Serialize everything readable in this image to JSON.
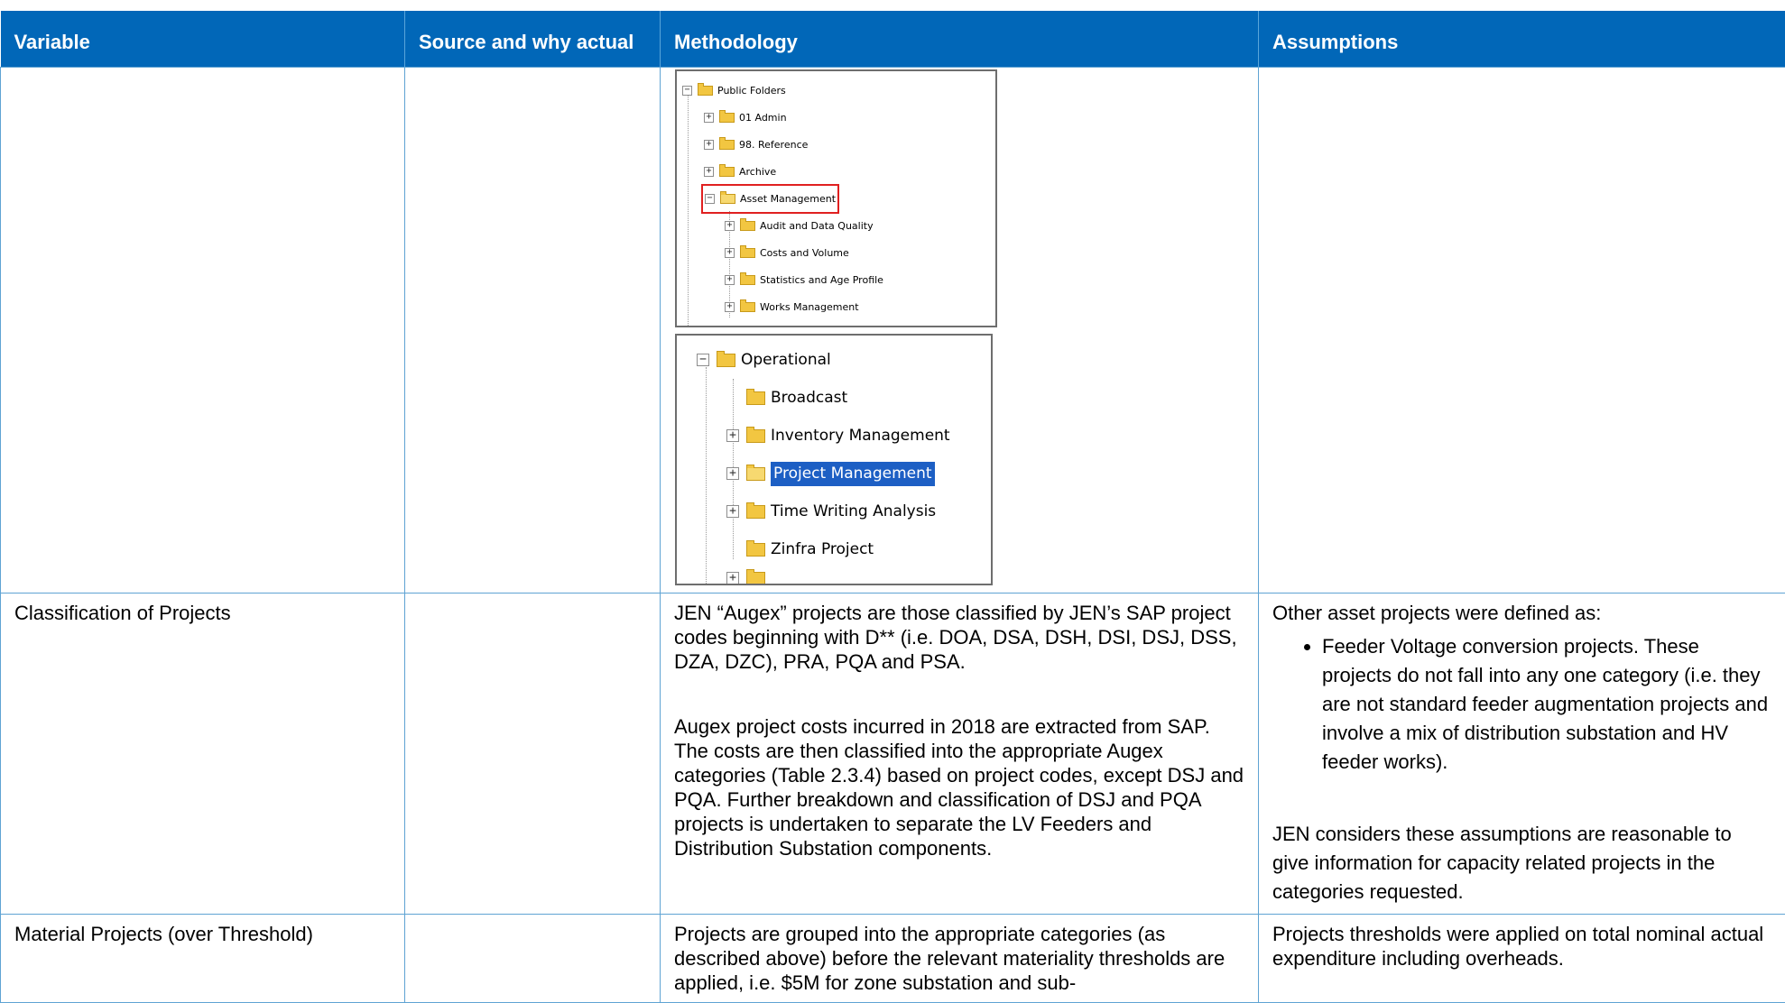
{
  "table": {
    "headers": {
      "variable": "Variable",
      "source": "Source and why actual",
      "methodology": "Methodology",
      "assumptions": "Assumptions"
    },
    "rows": [
      {
        "variable": "",
        "source": "",
        "tree1": {
          "root": "Public Folders",
          "items": [
            "01 Admin",
            "98. Reference",
            "Archive",
            "Asset Management"
          ],
          "sub_items": [
            "Audit and Data Quality",
            "Costs and Volume",
            "Statistics and Age Profile",
            "Works Management"
          ]
        },
        "tree2": {
          "root": "Operational",
          "items": [
            "Broadcast",
            "Inventory Management",
            "Project Management",
            "Time Writing Analysis",
            "Zinfra Project"
          ]
        },
        "assumptions": ""
      },
      {
        "variable": "Classification of Projects",
        "source": "",
        "methodology_p1": "JEN “Augex” projects are those classified by JEN’s SAP project codes beginning with D** (i.e. DOA, DSA, DSH, DSI, DSJ, DSS, DZA, DZC), PRA, PQA and PSA.",
        "methodology_p2": "Augex project costs incurred in 2018 are extracted from SAP. The costs are then classified into the appropriate Augex categories (Table 2.3.4) based on project codes, except DSJ and PQA. Further breakdown and classification of DSJ and PQA projects is undertaken to separate the LV Feeders and Distribution Substation components.",
        "assumptions_intro": "Other asset projects were defined as:",
        "assumptions_bullet": "Feeder Voltage conversion projects. These projects do not fall into any one category (i.e. they are not standard feeder augmentation projects and involve a mix of distribution substation and HV feeder works).",
        "assumptions_end": "JEN considers these assumptions are reasonable to give information for capacity related projects in the categories requested."
      },
      {
        "variable": "Material Projects (over Threshold)",
        "source": "",
        "methodology": "Projects are grouped into the appropriate categories (as described above) before the relevant materiality thresholds are applied, i.e. $5M for zone substation and sub-",
        "assumptions": "Projects thresholds were applied on total nominal actual expenditure including overheads."
      }
    ]
  }
}
